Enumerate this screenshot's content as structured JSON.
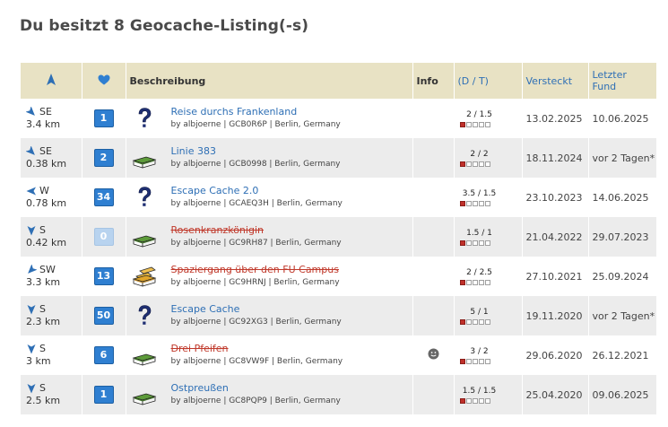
{
  "page": {
    "title": "Du besitzt 8 Geocache-Listing(-s)"
  },
  "table": {
    "headers": {
      "description": "Beschreibung",
      "info": "Info",
      "dt": "(D / T)",
      "hidden": "Versteckt",
      "last_found": "Letzter Fund"
    },
    "rows": [
      {
        "dir": "SE",
        "dist": "3.4 km",
        "fav": "1",
        "type": "mystery",
        "name": "Reise durchs Frankenland",
        "meta": "by albjoerne | GCB0R6P | Berlin, Germany",
        "disabled": false,
        "info": "",
        "dt": "2 / 1.5",
        "difficulty": 2,
        "terrain": 1.5,
        "hidden": "13.02.2025",
        "last_found": "10.06.2025"
      },
      {
        "dir": "SE",
        "dist": "0.38 km",
        "fav": "2",
        "type": "traditional",
        "name": "Linie 383",
        "meta": "by albjoerne | GCB0998 | Berlin, Germany",
        "disabled": false,
        "info": "",
        "dt": "2 / 2",
        "difficulty": 2,
        "terrain": 2,
        "hidden": "18.11.2024",
        "last_found": "vor 2 Tagen*"
      },
      {
        "dir": "W",
        "dist": "0.78 km",
        "fav": "34",
        "type": "mystery",
        "name": "Escape Cache 2.0",
        "meta": "by albjoerne | GCAEQ3H | Berlin, Germany",
        "disabled": false,
        "info": "",
        "dt": "3.5 / 1.5",
        "difficulty": 3.5,
        "terrain": 1.5,
        "hidden": "23.10.2023",
        "last_found": "14.06.2025"
      },
      {
        "dir": "S",
        "dist": "0.42 km",
        "fav": "0",
        "type": "traditional",
        "name": "Rosenkranzkönigin",
        "meta": "by albjoerne | GC9RH87 | Berlin, Germany",
        "disabled": true,
        "info": "",
        "dt": "1.5 / 1",
        "difficulty": 1.5,
        "terrain": 1,
        "hidden": "21.04.2022",
        "last_found": "29.07.2023"
      },
      {
        "dir": "SW",
        "dist": "3.3 km",
        "fav": "13",
        "type": "multi",
        "name": "Spaziergang über den FU Campus",
        "meta": "by albjoerne | GC9HRNJ | Berlin, Germany",
        "disabled": true,
        "info": "",
        "dt": "2 / 2.5",
        "difficulty": 2,
        "terrain": 2.5,
        "hidden": "27.10.2021",
        "last_found": "25.09.2024"
      },
      {
        "dir": "S",
        "dist": "2.3 km",
        "fav": "50",
        "type": "mystery",
        "name": "Escape Cache",
        "meta": "by albjoerne | GC92XG3 | Berlin, Germany",
        "disabled": false,
        "info": "",
        "dt": "5 / 1",
        "difficulty": 5,
        "terrain": 1,
        "hidden": "19.11.2020",
        "last_found": "vor 2 Tagen*"
      },
      {
        "dir": "S",
        "dist": "3 km",
        "fav": "6",
        "type": "traditional",
        "name": "Drei Pfeifen",
        "meta": "by albjoerne | GC8VW9F | Berlin, Germany",
        "disabled": true,
        "info": "smiley",
        "dt": "3 / 2",
        "difficulty": 3,
        "terrain": 2,
        "hidden": "29.06.2020",
        "last_found": "26.12.2021"
      },
      {
        "dir": "S",
        "dist": "2.5 km",
        "fav": "1",
        "type": "traditional",
        "name": "Ostpreußen",
        "meta": "by albjoerne | GC8PQP9 | Berlin, Germany",
        "disabled": false,
        "info": "",
        "dt": "1.5 / 1.5",
        "difficulty": 1.5,
        "terrain": 1.5,
        "hidden": "25.04.2020",
        "last_found": "09.06.2025"
      }
    ]
  },
  "icons": {
    "direction_header": "navigation-arrow-icon",
    "favorites_header": "heart-icon",
    "mystery": "question-mark-icon",
    "traditional": "traditional-cache-box-icon",
    "multi": "multi-cache-box-icon"
  },
  "colors": {
    "header_bg": "#e8e2c4",
    "link": "#2e6fb5",
    "disabled_link": "#c0392b",
    "favorite_badge": "#2f7fd1",
    "difficulty_fill": "#c0302a"
  }
}
